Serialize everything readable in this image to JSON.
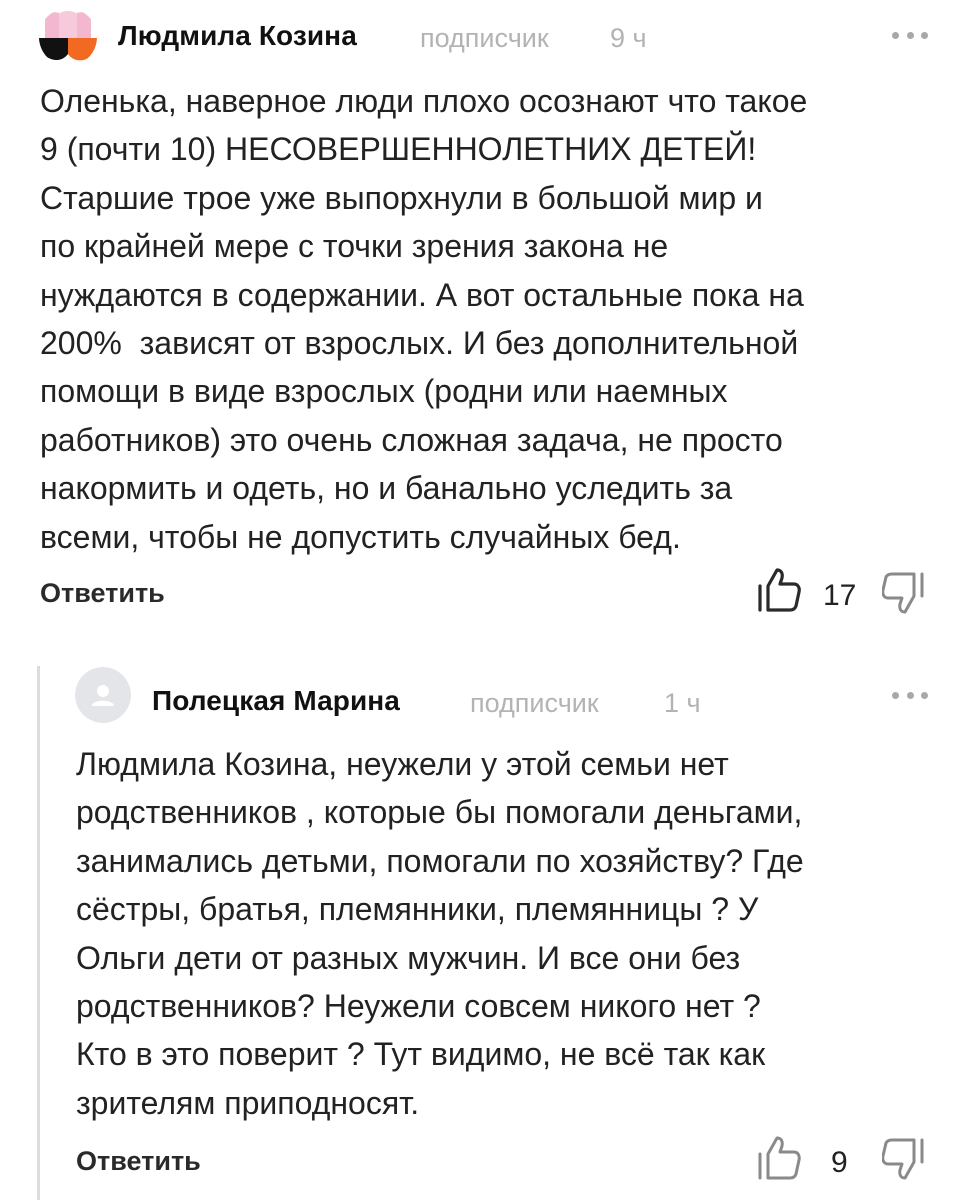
{
  "comments": [
    {
      "author": "Людмила Козина",
      "badge": "подписчик",
      "time": "9 ч",
      "text": "Оленька, наверное люди плохо осознают что такое\n9 (почти 10) НЕСОВЕРШЕННОЛЕТНИХ ДЕТЕЙ!\nСтаршие трое уже выпорхнули в большой мир и\nпо крайней мере с точки зрения закона не\nнуждаются в содержании. А вот остальные пока на\n200%  зависят от взрослых. И без дополнительной\nпомощи в виде взрослых (родни или наемных\nработников) это очень сложная задача, не просто\nнакормить и одеть, но и банально уследить за\nвсеми, чтобы не допустить случайных бед.",
      "reply_label": "Ответить",
      "likes": "17",
      "avatar_icon": "tulip-avatar-icon",
      "avatar_colors": {
        "top": "#f3b8d0",
        "bottom_left": "#111111",
        "bottom_right": "#f26a21"
      }
    },
    {
      "author": "Полецкая Марина",
      "badge": "подписчик",
      "time": "1 ч",
      "text": "Людмила Козина, неужели у этой семьи нет\nродственников , которые бы помогали деньгами,\nзанимались детьми, помогали по хозяйству? Где\nсёстры, братья, племянники, племянницы ? У\nОльги дети от разных мужчин. И все они без\nродственников? Неужели совсем никого нет ?\nКто в это поверит ? Тут видимо, не всё так как\nзрителям приподносят.",
      "reply_label": "Ответить",
      "likes": "9",
      "avatar_icon": "default-user-avatar-icon"
    }
  ],
  "colors": {
    "meta": "#b3b3b3",
    "text": "#222222",
    "thread_line": "#dcdcdc"
  }
}
